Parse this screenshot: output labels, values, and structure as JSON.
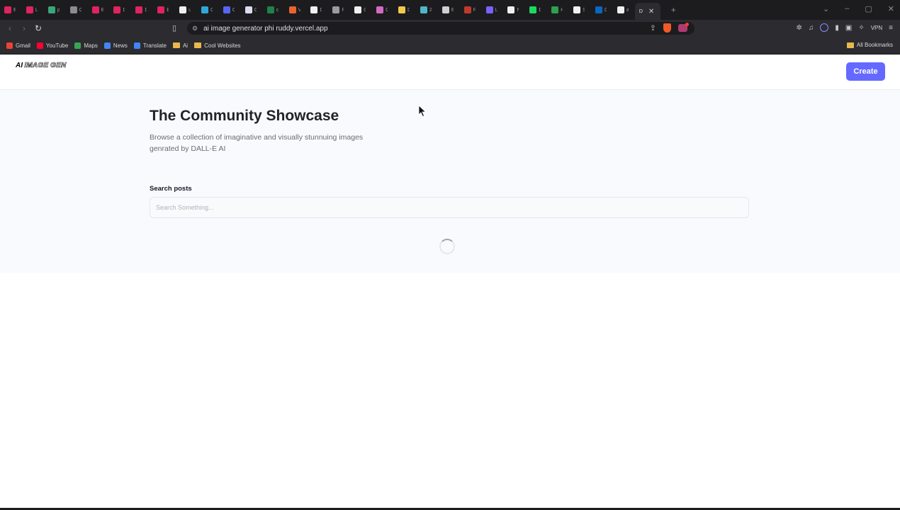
{
  "browser": {
    "tabs": [
      {
        "label": "E",
        "color": "#e0245e"
      },
      {
        "label": "L",
        "color": "#e0245e"
      },
      {
        "label": "p",
        "color": "#3aa57a"
      },
      {
        "label": "C",
        "color": "#8a8a90"
      },
      {
        "label": "B",
        "color": "#e0245e"
      },
      {
        "label": "D",
        "color": "#e0245e"
      },
      {
        "label": "D",
        "color": "#e0245e"
      },
      {
        "label": "B",
        "color": "#e0245e"
      },
      {
        "label": "u",
        "color": "#f0f0f0"
      },
      {
        "label": "C",
        "color": "#2fa8d8"
      },
      {
        "label": "C",
        "color": "#5865f2"
      },
      {
        "label": "C",
        "color": "#dcdcf0"
      },
      {
        "label": "c",
        "color": "#1d8348"
      },
      {
        "label": "V",
        "color": "#e8642c"
      },
      {
        "label": "D",
        "color": "#f0f0f0"
      },
      {
        "label": "R",
        "color": "#9a9aa0"
      },
      {
        "label": "C",
        "color": "#f0f0f0"
      },
      {
        "label": "G",
        "color": "#d36ac2"
      },
      {
        "label": "D",
        "color": "#f2c94c"
      },
      {
        "label": "2",
        "color": "#4fb6c8"
      },
      {
        "label": "E",
        "color": "#cfcfd3"
      },
      {
        "label": "R",
        "color": "#c0392b"
      },
      {
        "label": "L",
        "color": "#7b61ff"
      },
      {
        "label": "N",
        "color": "#f0f0f0"
      },
      {
        "label": "D",
        "color": "#1ed760"
      },
      {
        "label": "H",
        "color": "#2e9e4f"
      },
      {
        "label": "S",
        "color": "#f0f0f0"
      },
      {
        "label": "D",
        "color": "#0a66c2"
      },
      {
        "label": "a",
        "color": "#f0f0f0"
      }
    ],
    "active_tab": {
      "label": "D",
      "close": "✕"
    },
    "new_tab": "+",
    "url": "ai image generator phi ruddy.vercel.app",
    "vpn_label": "VPN",
    "bookmarks": [
      {
        "label": "Gmail",
        "color": "#ea4335"
      },
      {
        "label": "YouTube",
        "color": "#ff0033"
      },
      {
        "label": "Maps",
        "color": "#34a853"
      },
      {
        "label": "News",
        "color": "#4285f4"
      },
      {
        "label": "Translate",
        "color": "#4285f4"
      },
      {
        "label": "Ai",
        "color": "#e8b84a"
      },
      {
        "label": "Cool Websites",
        "color": "#e8b84a"
      }
    ],
    "all_bookmarks": "All Bookmarks"
  },
  "site": {
    "logo_ai": "AI",
    "logo_rest": "IMAGE GEN",
    "create_label": "Create",
    "accent": "#6469ff"
  },
  "main": {
    "title": "The Community Showcase",
    "description": "Browse a collection of imaginative and visually stunnuing images genrated by DALL-E AI",
    "search_label": "Search posts",
    "search_placeholder": "Search Something...",
    "search_value": ""
  }
}
